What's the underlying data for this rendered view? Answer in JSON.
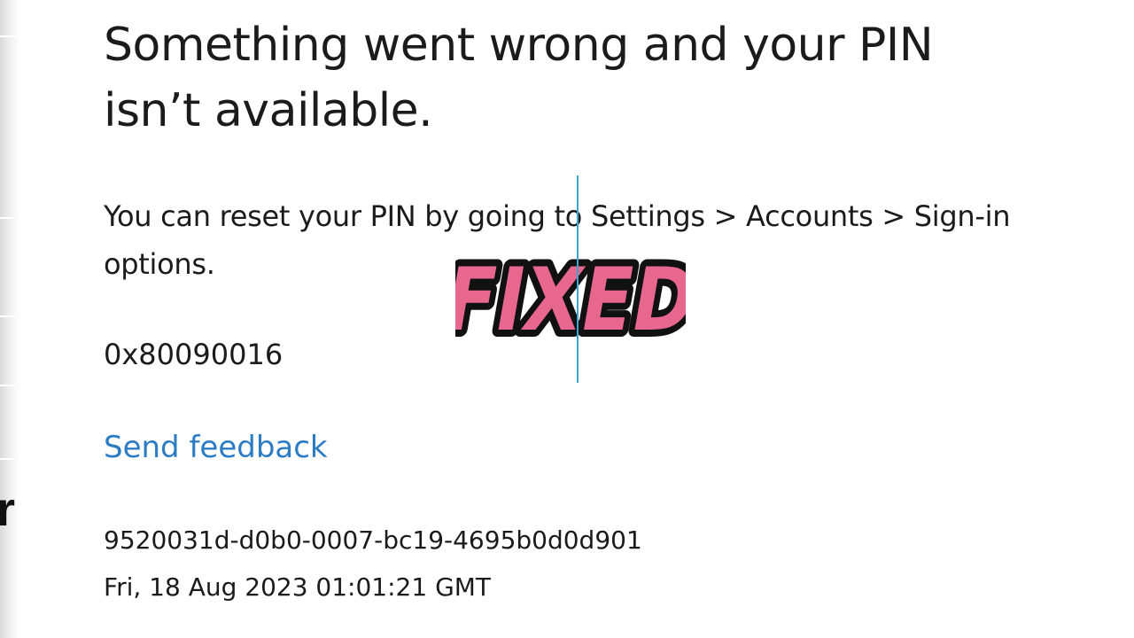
{
  "dialog": {
    "heading": "Something went wrong and your PIN isn’t available.",
    "message": "You can reset your PIN by going to Settings > Accounts > Sign-in options.",
    "error_code": "0x80090016",
    "feedback_link": "Send feedback",
    "correlation_id": "9520031d-d0b0-0007-bc19-4695b0d0d901",
    "timestamp": "Fri, 18 Aug 2023 01:01:21 GMT"
  },
  "overlay": {
    "badge_text": "FIXED",
    "badge_fill": "#e8678f",
    "badge_outline": "#111111"
  },
  "background_fragment": {
    "text": "r"
  },
  "colors": {
    "link": "#2b7cc5",
    "text": "#1b1b1b",
    "cursor": "#3aa6c9"
  }
}
